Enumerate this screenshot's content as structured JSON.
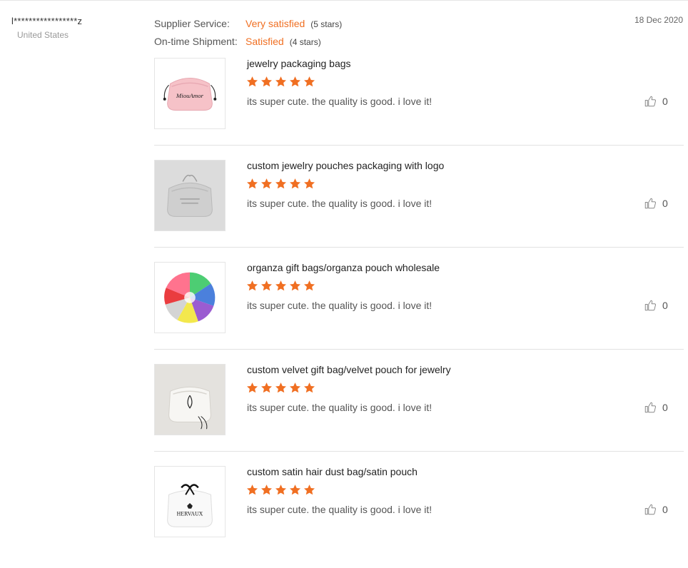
{
  "reviewer": {
    "name": "l*****************z",
    "country": "United States"
  },
  "date": "18 Dec 2020",
  "ratings": [
    {
      "label": "Supplier Service:",
      "value": "Very satisfied",
      "stars": "(5 stars)"
    },
    {
      "label": "On-time Shipment:",
      "value": "Satisfied",
      "stars": "(4 stars)"
    }
  ],
  "colors": {
    "accent": "#f06f22",
    "star": "#f06f22",
    "divider": "#e2e2e2"
  },
  "products": [
    {
      "title": "jewelry packaging bags",
      "rating": 5,
      "text": "its super cute. the quality is good. i love it!",
      "likes": "0",
      "image_brand": "MiouAmor"
    },
    {
      "title": "custom jewelry pouches packaging with logo",
      "rating": 5,
      "text": "its super cute. the quality is good. i love it!",
      "likes": "0",
      "image_brand": ""
    },
    {
      "title": "organza gift bags/organza pouch wholesale",
      "rating": 5,
      "text": "its super cute. the quality is good. i love it!",
      "likes": "0",
      "image_brand": ""
    },
    {
      "title": "custom velvet gift bag/velvet pouch for jewelry",
      "rating": 5,
      "text": "its super cute. the quality is good. i love it!",
      "likes": "0",
      "image_brand": ""
    },
    {
      "title": "custom satin hair dust bag/satin pouch",
      "rating": 5,
      "text": "its super cute. the quality is good. i love it!",
      "likes": "0",
      "image_brand": "HERVAUX"
    }
  ],
  "icons": {
    "star": "star-icon",
    "like": "thumbs-up-icon"
  }
}
